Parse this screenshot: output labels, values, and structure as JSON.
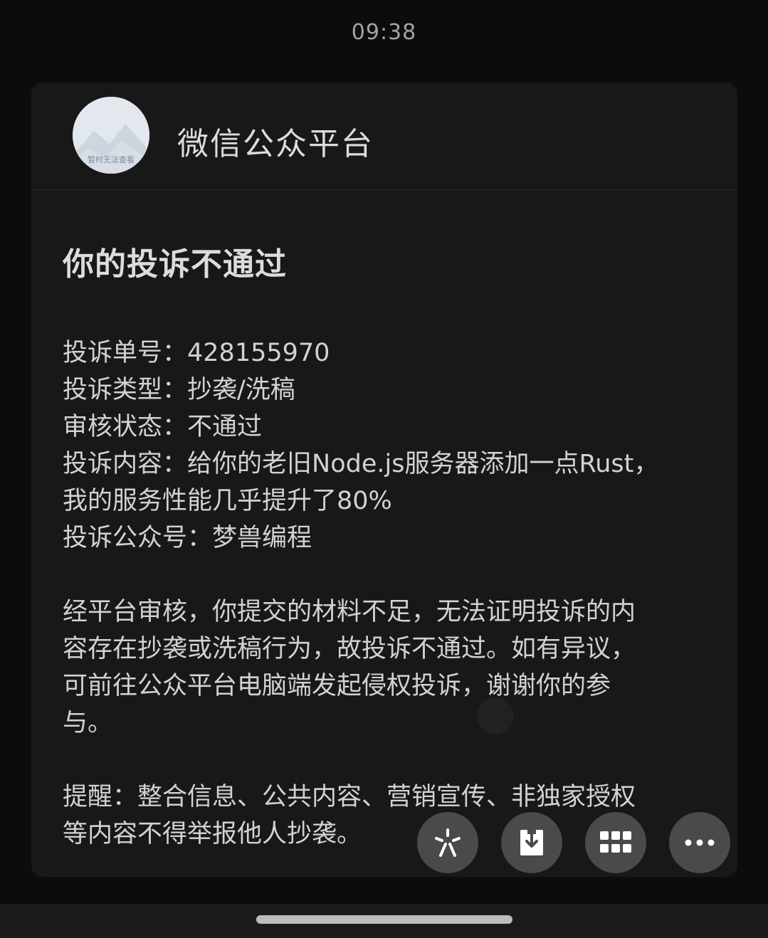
{
  "status_bar": {
    "time": "09:38"
  },
  "header": {
    "avatar_caption": "暂时无法查看",
    "account_name": "微信公众平台"
  },
  "message": {
    "headline": "你的投诉不通过",
    "fields": [
      {
        "label": "投诉单号：",
        "value": "428155970"
      },
      {
        "label": "投诉类型：",
        "value": "抄袭/洗稿"
      },
      {
        "label": "审核状态：",
        "value": "不通过"
      },
      {
        "label": "投诉内容：",
        "value": "给你的老旧Node.js服务器添加一点Rust，",
        "continuation": "我的服务性能几乎提升了80%"
      },
      {
        "label": "投诉公众号：",
        "value": "梦兽编程"
      }
    ],
    "review_lines": [
      "经平台审核，你提交的材料不足，无法证明投诉的内",
      "容存在抄袭或洗稿行为，故投诉不通过。如有异议，",
      "可前往公众平台电脑端发起侵权投诉，谢谢你的参",
      "与。"
    ],
    "reminder_lines": [
      "提醒：整合信息、公共内容、营销宣传、非独家授权",
      "等内容不得举报他人抄袭。"
    ]
  },
  "floating_actions": [
    {
      "icon": "sparkle-icon"
    },
    {
      "icon": "download-icon"
    },
    {
      "icon": "grid-icon"
    },
    {
      "icon": "more-icon"
    }
  ],
  "colors": {
    "background": "#0c0c0c",
    "card": "#181818",
    "text": "#d2d2d2",
    "fab": "#4a4a4a"
  }
}
